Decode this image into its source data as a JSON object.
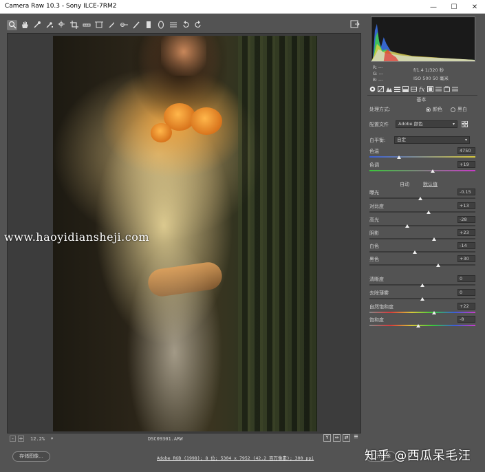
{
  "window": {
    "title": "Camera Raw 10.3 -  Sony ILCE-7RM2",
    "minimize": "—",
    "maximize": "☐",
    "close": "✕"
  },
  "toolbar": {
    "tools": [
      "zoom-tool-icon",
      "hand-tool-icon",
      "white-balance-icon",
      "color-sampler-icon",
      "targeted-adjustment-icon",
      "crop-icon",
      "straighten-icon",
      "transform-icon",
      "spot-removal-icon",
      "red-eye-icon",
      "adjustment-brush-icon",
      "graduated-filter-icon",
      "radial-filter-icon",
      "presets-icon",
      "rotate-left-icon",
      "rotate-right-icon"
    ]
  },
  "canvas": {
    "watermark": "www.haoyidiansheji.com"
  },
  "bottom": {
    "zoom_minus": "-",
    "zoom_plus": "+",
    "zoom_value": "12.2%",
    "filename": "DSC09301.ARW",
    "view_y": "Y",
    "view_compare": "⇔",
    "view_swap": "⇄",
    "view_settings": "☰"
  },
  "footer": {
    "save_label": "存储图像...",
    "workflow_link": "Adobe RGB (1998); 8 位; 5304 x 7952 (42.2 百万像素); 300 ppi",
    "open_label": "打开图像",
    "zhihu_watermark": "知乎 @西瓜呆毛汪"
  },
  "readout": {
    "r": "R:  ---",
    "g": "G:  ---",
    "b": "B:  ---",
    "aperture_shutter": "f/1.4   1/320 秒",
    "iso_focal": "ISO 500   50 毫米"
  },
  "panel": {
    "section_title": "基本",
    "treatment_label": "处理方式:",
    "treatment_color": "颜色",
    "treatment_bw": "黑白",
    "profile_label": "配置文件",
    "profile_value": "Adobe 颜色",
    "wb_label": "白平衡:",
    "wb_value": "自定",
    "auto_label": "自动",
    "default_label": "默认值"
  },
  "sliders": {
    "temperature": {
      "label": "色温",
      "value": "4750",
      "fraction": 0.28
    },
    "tint": {
      "label": "色调",
      "value": "+19",
      "fraction": 0.6
    },
    "exposure": {
      "label": "曝光",
      "value": "-0.15",
      "fraction": 0.48
    },
    "contrast": {
      "label": "对比度",
      "value": "+13",
      "fraction": 0.56
    },
    "highlights": {
      "label": "高光",
      "value": "-28",
      "fraction": 0.36
    },
    "shadows": {
      "label": "阴影",
      "value": "+23",
      "fraction": 0.61
    },
    "whites": {
      "label": "白色",
      "value": "-14",
      "fraction": 0.43
    },
    "blacks": {
      "label": "黑色",
      "value": "+30",
      "fraction": 0.65
    },
    "clarity": {
      "label": "清晰度",
      "value": "0",
      "fraction": 0.5
    },
    "dehaze": {
      "label": "去除薄雾",
      "value": "0",
      "fraction": 0.5
    },
    "vibrance": {
      "label": "自然饱和度",
      "value": "+22",
      "fraction": 0.61
    },
    "saturation": {
      "label": "饱和度",
      "value": "-8",
      "fraction": 0.46
    }
  },
  "colors": {
    "panel_bg": "#535353",
    "canvas_bg": "#3c3c3c",
    "thumb": "#eeeeee"
  }
}
